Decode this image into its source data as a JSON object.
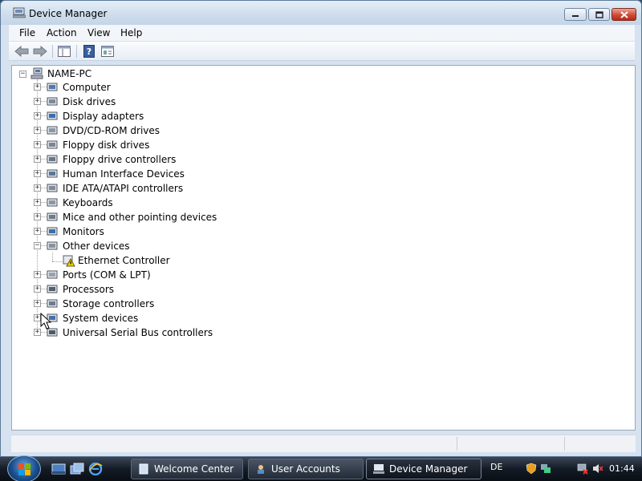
{
  "window": {
    "title": "Device Manager",
    "icon": "device-manager-icon",
    "controls": [
      "minimize",
      "maximize",
      "close"
    ]
  },
  "menu": {
    "items": [
      {
        "label": "File"
      },
      {
        "label": "Action"
      },
      {
        "label": "View"
      },
      {
        "label": "Help"
      }
    ]
  },
  "toolbar": {
    "buttons": [
      {
        "icon": "back-arrow-icon"
      },
      {
        "icon": "forward-arrow-icon"
      },
      {
        "icon": "show-hide-console-tree-icon"
      },
      {
        "icon": "help-icon"
      },
      {
        "icon": "properties-icon"
      }
    ]
  },
  "tree": {
    "root": {
      "label": "NAME-PC",
      "icon": "computer-network-icon",
      "expanded": true
    },
    "nodes": [
      {
        "label": "Computer",
        "icon": "computer-icon",
        "expanded": false
      },
      {
        "label": "Disk drives",
        "icon": "disk-drive-icon",
        "expanded": false
      },
      {
        "label": "Display adapters",
        "icon": "display-adapter-icon",
        "expanded": false
      },
      {
        "label": "DVD/CD-ROM drives",
        "icon": "dvd-drive-icon",
        "expanded": false
      },
      {
        "label": "Floppy disk drives",
        "icon": "floppy-drive-icon",
        "expanded": false
      },
      {
        "label": "Floppy drive controllers",
        "icon": "floppy-controller-icon",
        "expanded": false
      },
      {
        "label": "Human Interface Devices",
        "icon": "hid-icon",
        "expanded": false
      },
      {
        "label": "IDE ATA/ATAPI controllers",
        "icon": "ide-controller-icon",
        "expanded": false
      },
      {
        "label": "Keyboards",
        "icon": "keyboard-icon",
        "expanded": false
      },
      {
        "label": "Mice and other pointing devices",
        "icon": "mouse-icon",
        "expanded": false
      },
      {
        "label": "Monitors",
        "icon": "monitor-icon",
        "expanded": false
      },
      {
        "label": "Other devices",
        "icon": "other-devices-icon",
        "expanded": true,
        "children": [
          {
            "label": "Ethernet Controller",
            "icon": "warning-device-icon"
          }
        ]
      },
      {
        "label": "Ports (COM & LPT)",
        "icon": "port-icon",
        "expanded": false
      },
      {
        "label": "Processors",
        "icon": "processor-icon",
        "expanded": false
      },
      {
        "label": "Storage controllers",
        "icon": "storage-controller-icon",
        "expanded": false
      },
      {
        "label": "System devices",
        "icon": "system-devices-icon",
        "expanded": false
      },
      {
        "label": "Universal Serial Bus controllers",
        "icon": "usb-icon",
        "expanded": false
      }
    ]
  },
  "taskbar": {
    "start_icon": "windows-start-orb",
    "quick_launch": [
      "show-desktop-icon",
      "switch-windows-icon",
      "internet-explorer-icon"
    ],
    "tasks": [
      {
        "label": "Welcome Center",
        "icon": "welcome-center-icon",
        "active": false
      },
      {
        "label": "User Accounts",
        "icon": "user-accounts-icon",
        "active": false
      },
      {
        "label": "Device Manager",
        "icon": "device-manager-icon",
        "active": true
      }
    ],
    "language": "DE",
    "tray_icons": [
      "security-shield-icon",
      "network-icon",
      "network-disconnected-icon",
      "volume-muted-icon"
    ],
    "clock": "01:44"
  },
  "colors": {
    "title_gradient_top": "#e4eef8",
    "close_button": "#cf4b34",
    "taskbar": "#141b25",
    "window_frame": "#d6e2ef"
  }
}
